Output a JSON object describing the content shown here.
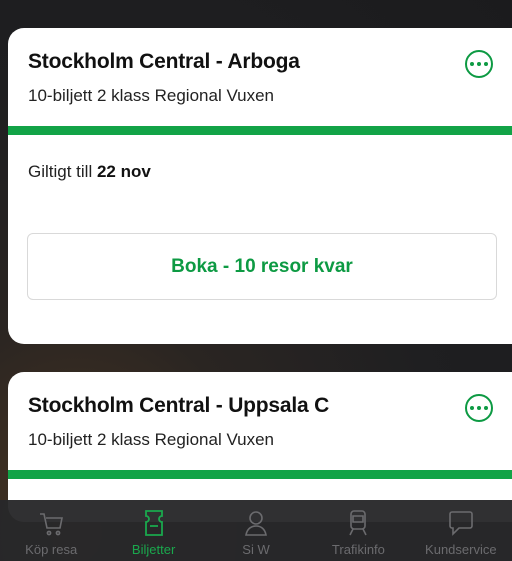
{
  "tickets": [
    {
      "route": "Stockholm Central - Arboga",
      "ticket_type": "10-biljett 2 klass Regional Vuxen",
      "valid_prefix": "Giltigt till",
      "valid_date": "22 nov",
      "book_label": "Boka - 10 resor kvar"
    },
    {
      "route": "Stockholm Central - Uppsala C",
      "ticket_type": "10-biljett 2 klass Regional Vuxen"
    }
  ],
  "tabbar": {
    "items": [
      {
        "label": "Köp resa",
        "icon": "cart-icon"
      },
      {
        "label": "Biljetter",
        "icon": "ticket-icon"
      },
      {
        "label": "Si W",
        "icon": "person-icon"
      },
      {
        "label": "Trafikinfo",
        "icon": "train-icon"
      },
      {
        "label": "Kundservice",
        "icon": "chat-bubble-icon"
      }
    ],
    "active_index": 1,
    "active_color": "#1aa84d"
  },
  "colors": {
    "accent": "#12a347",
    "tabbar_bg": "#28282a"
  }
}
